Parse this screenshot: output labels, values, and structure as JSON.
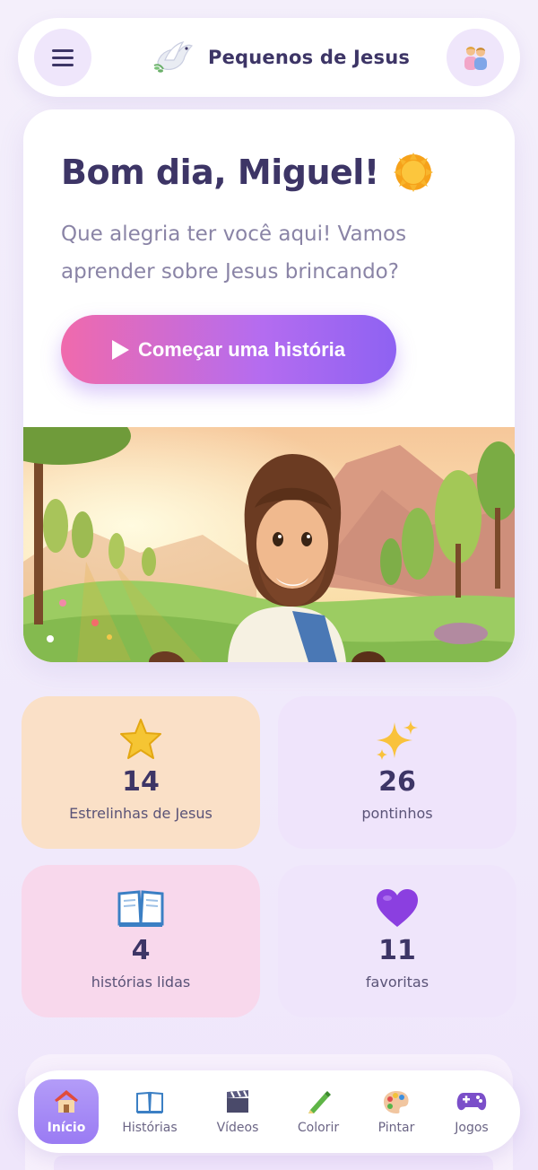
{
  "header": {
    "title": "Pequenos de Jesus",
    "menu_icon": "hamburger-icon",
    "logo_icon": "dove-icon",
    "profile_icon": "parents-icon"
  },
  "hero": {
    "greeting": "Bom dia, Miguel!",
    "greeting_icon": "sun-icon",
    "subtitle": "Que alegria ter você aqui! Vamos aprender sobre Jesus brincando?",
    "cta_label": "Começar uma história",
    "cta_icon": "play-icon",
    "illustration": "jesus-landscape-illustration"
  },
  "stats": [
    {
      "icon": "star-icon",
      "value": "14",
      "label": "Estrelinhas de Jesus",
      "color": "#fae0c7"
    },
    {
      "icon": "sparkles-icon",
      "value": "26",
      "label": "pontinhos",
      "color": "#efe4fb"
    },
    {
      "icon": "book-icon",
      "value": "4",
      "label": "histórias lidas",
      "color": "#f8d8ec"
    },
    {
      "icon": "heart-icon",
      "value": "11",
      "label": "favoritas",
      "color": "#efe5fb"
    }
  ],
  "nav": {
    "items": [
      {
        "label": "Início",
        "icon": "house-icon",
        "active": true
      },
      {
        "label": "Histórias",
        "icon": "book-icon"
      },
      {
        "label": "Vídeos",
        "icon": "clapperboard-icon"
      },
      {
        "label": "Colorir",
        "icon": "crayon-icon"
      },
      {
        "label": "Pintar",
        "icon": "palette-icon"
      },
      {
        "label": "Jogos",
        "icon": "gamepad-icon"
      }
    ]
  },
  "colors": {
    "primary_text": "#3d3566",
    "muted_text": "#8a84a6",
    "accent_gradient_start": "#f06aac",
    "accent_gradient_end": "#8e62f2",
    "nav_active": "#9a7bf3"
  }
}
